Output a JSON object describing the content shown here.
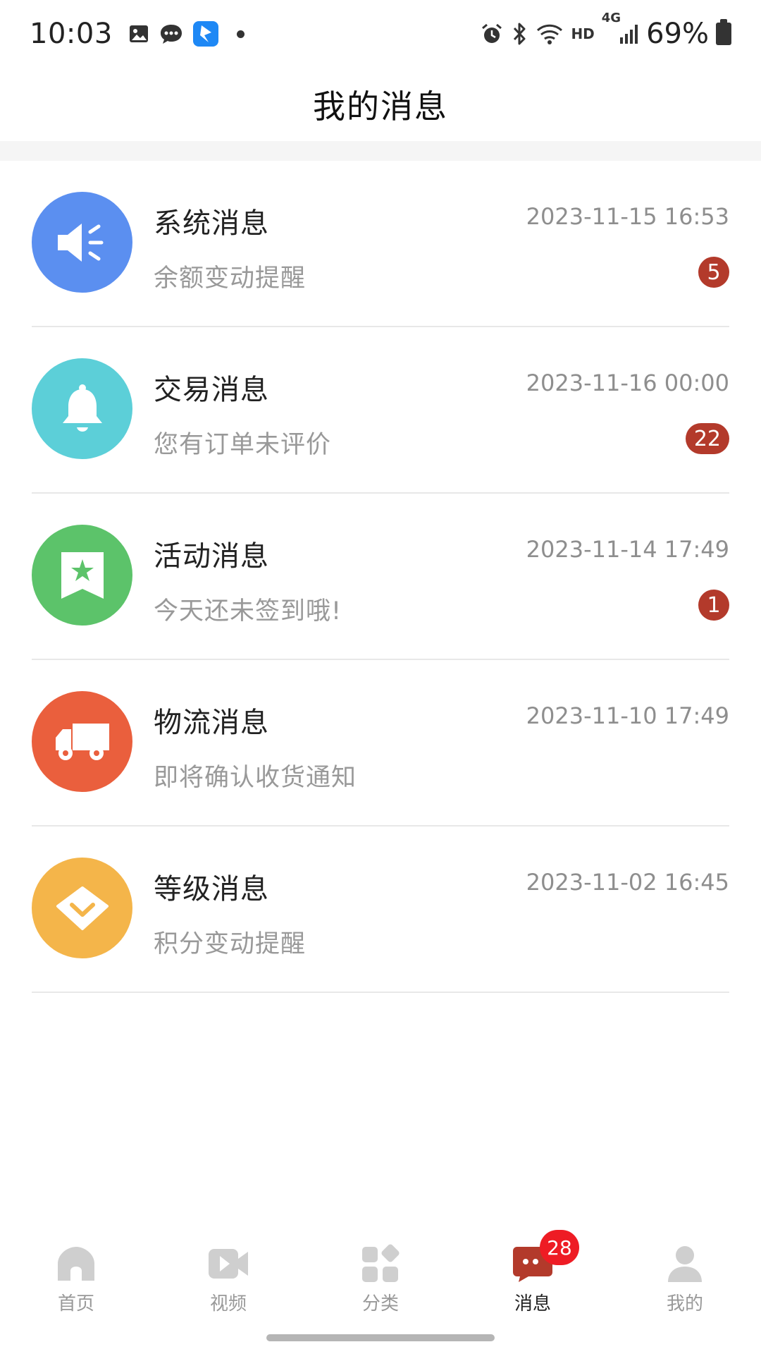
{
  "status_bar": {
    "time": "10:03",
    "network_label": "HD",
    "network_type": "4G",
    "battery_percent": "69%",
    "left_icons": [
      "gallery-icon",
      "chat-icon",
      "app-icon"
    ],
    "right_icons": [
      "alarm-icon",
      "bluetooth-icon",
      "wifi-icon",
      "signal-icon",
      "battery-icon"
    ]
  },
  "header": {
    "title": "我的消息"
  },
  "messages": [
    {
      "title": "系统消息",
      "time": "2023-11-15 16:53",
      "subtitle": "余额变动提醒",
      "badge": "5",
      "icon": "speaker-icon",
      "color": "#5b8ff0"
    },
    {
      "title": "交易消息",
      "time": "2023-11-16 00:00",
      "subtitle": "您有订单未评价",
      "badge": "22",
      "icon": "bell-icon",
      "color": "#5ccfd8"
    },
    {
      "title": "活动消息",
      "time": "2023-11-14 17:49",
      "subtitle": "今天还未签到哦!",
      "badge": "1",
      "icon": "bookmark-star-icon",
      "color": "#5cc36a"
    },
    {
      "title": "物流消息",
      "time": "2023-11-10 17:49",
      "subtitle": "即将确认收货通知",
      "badge": "",
      "icon": "truck-icon",
      "color": "#ea5f3d"
    },
    {
      "title": "等级消息",
      "time": "2023-11-02 16:45",
      "subtitle": "积分变动提醒",
      "badge": "",
      "icon": "diamond-icon",
      "color": "#f4b54a"
    }
  ],
  "tabs": [
    {
      "label": "首页",
      "icon": "home-icon",
      "active": false
    },
    {
      "label": "视频",
      "icon": "video-icon",
      "active": false
    },
    {
      "label": "分类",
      "icon": "category-icon",
      "active": false
    },
    {
      "label": "消息",
      "icon": "message-icon",
      "active": true,
      "badge": "28"
    },
    {
      "label": "我的",
      "icon": "profile-icon",
      "active": false
    }
  ],
  "colors": {
    "badge": "#b33a2b",
    "tab_badge": "#ee1c24",
    "active_tab_icon": "#b33a2b",
    "inactive_tab": "#cccccc"
  }
}
